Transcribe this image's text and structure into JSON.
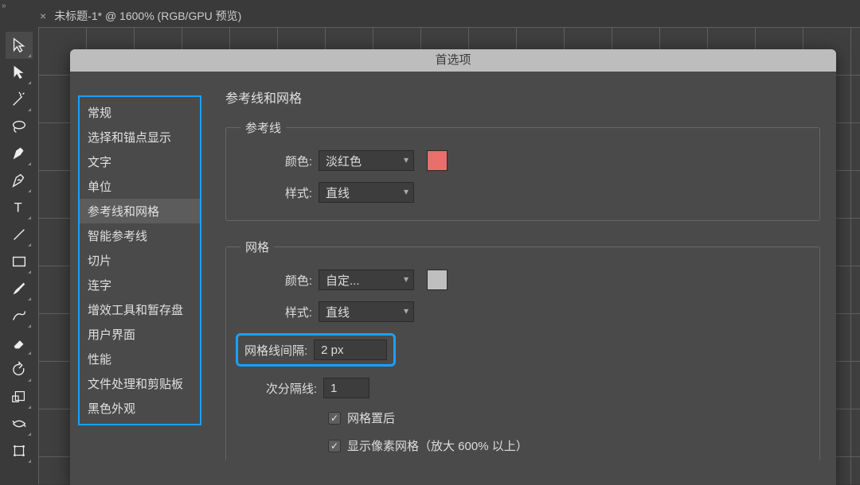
{
  "tab": {
    "close_glyph": "×",
    "title": "未标题-1* @ 1600% (RGB/GPU 预览)"
  },
  "dialog": {
    "title": "首选项",
    "categories": [
      "常规",
      "选择和锚点显示",
      "文字",
      "单位",
      "参考线和网格",
      "智能参考线",
      "切片",
      "连字",
      "增效工具和暂存盘",
      "用户界面",
      "性能",
      "文件处理和剪贴板",
      "黑色外观"
    ],
    "selected_index": 4,
    "pane_title": "参考线和网格",
    "guides": {
      "legend": "参考线",
      "color_label": "颜色:",
      "color_value": "淡红色",
      "color_hex": "#e86f6c",
      "style_label": "样式:",
      "style_value": "直线"
    },
    "grid": {
      "legend": "网格",
      "color_label": "颜色:",
      "color_value": "自定...",
      "color_hex": "#bfbfbf",
      "style_label": "样式:",
      "style_value": "直线",
      "gridline_label": "网格线间隔:",
      "gridline_value": "2 px",
      "subdiv_label": "次分隔线:",
      "subdiv_value": "1",
      "grids_back_label": "网格置后",
      "show_pixel_grid_label": "显示像素网格（放大 600% 以上）"
    }
  }
}
